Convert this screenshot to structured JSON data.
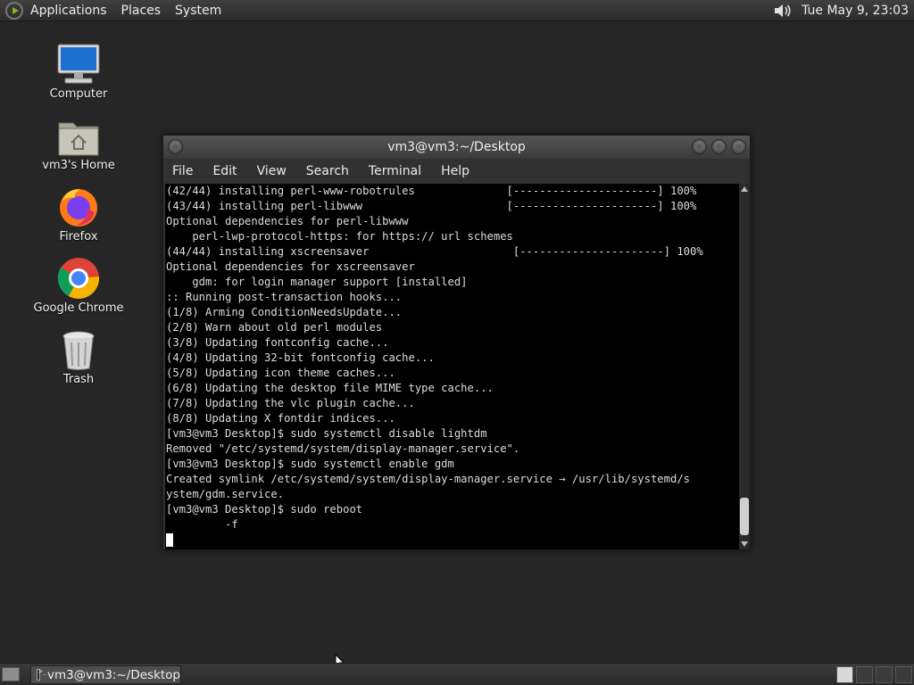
{
  "top_panel": {
    "menus": [
      "Applications",
      "Places",
      "System"
    ],
    "clock": "Tue May  9, 23:03",
    "icons": {
      "logo": "distro-menu-icon",
      "volume": "speaker-icon"
    }
  },
  "desktop_icons": [
    {
      "label": "Computer",
      "icon": "computer-icon"
    },
    {
      "label": "vm3's Home",
      "icon": "home-folder-icon"
    },
    {
      "label": "Firefox",
      "icon": "firefox-icon"
    },
    {
      "label": "Google Chrome",
      "icon": "chrome-icon"
    },
    {
      "label": "Trash",
      "icon": "trash-icon"
    }
  ],
  "terminal": {
    "title": "vm3@vm3:~/Desktop",
    "menu": [
      "File",
      "Edit",
      "View",
      "Search",
      "Terminal",
      "Help"
    ],
    "lines": [
      "(42/44) installing perl-www-robotrules              [----------------------] 100%",
      "(43/44) installing perl-libwww                      [----------------------] 100%",
      "Optional dependencies for perl-libwww",
      "    perl-lwp-protocol-https: for https:// url schemes",
      "(44/44) installing xscreensaver                      [----------------------] 100%",
      "Optional dependencies for xscreensaver",
      "    gdm: for login manager support [installed]",
      ":: Running post-transaction hooks...",
      "(1/8) Arming ConditionNeedsUpdate...",
      "(2/8) Warn about old perl modules",
      "(3/8) Updating fontconfig cache...",
      "(4/8) Updating 32-bit fontconfig cache...",
      "(5/8) Updating icon theme caches...",
      "(6/8) Updating the desktop file MIME type cache...",
      "(7/8) Updating the vlc plugin cache...",
      "(8/8) Updating X fontdir indices...",
      "[vm3@vm3 Desktop]$ sudo systemctl disable lightdm",
      "Removed \"/etc/systemd/system/display-manager.service\".",
      "[vm3@vm3 Desktop]$ sudo systemctl enable gdm",
      "Created symlink /etc/systemd/system/display-manager.service → /usr/lib/systemd/s",
      "ystem/gdm.service.",
      "[vm3@vm3 Desktop]$ sudo reboot",
      "         -f"
    ]
  },
  "taskbar": {
    "tasks": [
      {
        "label": "vm3@vm3:~/Desktop",
        "icon": "terminal-icon"
      }
    ]
  },
  "colors": {
    "desktop_bg": "#262626",
    "panel_bg": "#333333",
    "terminal_bg": "#000000",
    "terminal_fg": "#dcdcdc"
  }
}
